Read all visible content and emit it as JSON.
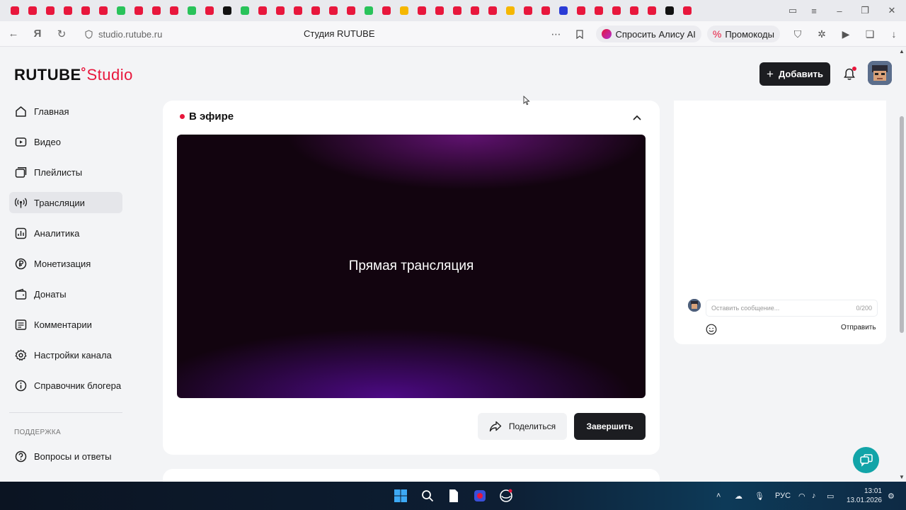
{
  "browser": {
    "tab_favicon_colors": [
      "#e8173c",
      "#e8173c",
      "#e8173c",
      "#e8173c",
      "#e8173c",
      "#e8173c",
      "#29c35a",
      "#e8173c",
      "#e8173c",
      "#e8173c",
      "#29c35a",
      "#e8173c",
      "#111111",
      "#29c35a",
      "#e8173c",
      "#e8173c",
      "#e8173c",
      "#e8173c",
      "#e8173c",
      "#e8173c",
      "#29c35a",
      "#e8173c",
      "#f5b700",
      "#e8173c",
      "#e8173c",
      "#e8173c",
      "#e8173c",
      "#e8173c",
      "#f5b700",
      "#e8173c",
      "#e8173c",
      "#2a3bd6",
      "#e8173c",
      "#e8173c",
      "#e8173c",
      "#e8173c",
      "#e8173c",
      "#111111",
      "#e8173c"
    ],
    "url": "studio.rutube.ru",
    "page_title": "Студия RUTUBE",
    "ask_alice_label": "Спросить Алису AI",
    "promo_label": "Промокоды"
  },
  "header": {
    "logo_text": "RUTUBE",
    "logo_suffix": "Studio",
    "add_button_label": "Добавить",
    "accent_color": "#e8173c"
  },
  "sidebar": {
    "items": [
      {
        "label": "Главная",
        "icon": "home-icon"
      },
      {
        "label": "Видео",
        "icon": "video-icon"
      },
      {
        "label": "Плейлисты",
        "icon": "playlist-icon"
      },
      {
        "label": "Трансляции",
        "icon": "broadcast-icon",
        "active": true
      },
      {
        "label": "Аналитика",
        "icon": "analytics-icon"
      },
      {
        "label": "Монетизация",
        "icon": "ruble-icon"
      },
      {
        "label": "Донаты",
        "icon": "wallet-icon"
      },
      {
        "label": "Комментарии",
        "icon": "comments-icon"
      },
      {
        "label": "Настройки канала",
        "icon": "gear-icon"
      },
      {
        "label": "Справочник блогера",
        "icon": "info-icon"
      }
    ],
    "support_section_label": "ПОДДЕРЖКА",
    "support_items": [
      {
        "label": "Вопросы и ответы",
        "icon": "question-icon"
      }
    ]
  },
  "live": {
    "title": "В эфире",
    "player_label": "Прямая трансляция",
    "share_label": "Поделиться",
    "finish_label": "Завершить"
  },
  "chat": {
    "input_placeholder": "Оставить сообщение...",
    "char_counter": "0/200",
    "send_label": "Отправить"
  },
  "taskbar": {
    "language": "РУС",
    "time": "13:01",
    "date": "13.01.2026"
  }
}
